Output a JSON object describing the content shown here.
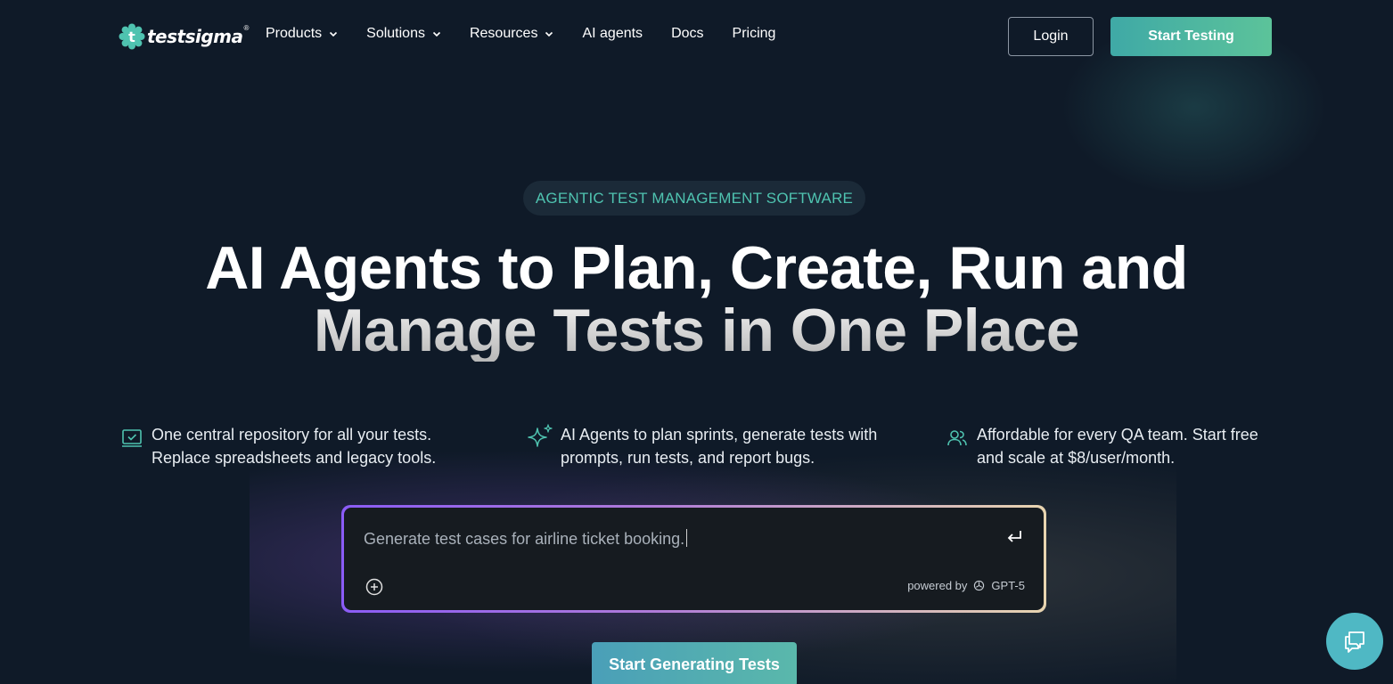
{
  "brand": {
    "name": "testsigma",
    "registered": "®",
    "accent": "#4fc3b0"
  },
  "nav": {
    "items": [
      {
        "label": "Products",
        "has_dropdown": true
      },
      {
        "label": "Solutions",
        "has_dropdown": true
      },
      {
        "label": "Resources",
        "has_dropdown": true
      },
      {
        "label": "AI agents",
        "has_dropdown": false
      },
      {
        "label": "Docs",
        "has_dropdown": false
      },
      {
        "label": "Pricing",
        "has_dropdown": false
      }
    ],
    "login_label": "Login",
    "start_label": "Start Testing"
  },
  "hero": {
    "badge": "AGENTIC TEST MANAGEMENT SOFTWARE",
    "headline_line1": "AI Agents to Plan, Create, Run and",
    "headline_line2": "Manage Tests in One Place",
    "features": [
      {
        "icon": "checked-monitor-icon",
        "line1": "One central repository for all your tests.",
        "line2": "Replace spreadsheets and legacy tools."
      },
      {
        "icon": "sparkle-icon",
        "line1": "AI Agents to plan sprints, generate tests with",
        "line2": "prompts, run tests, and report bugs."
      },
      {
        "icon": "users-icon",
        "line1": "Affordable for every QA team. Start free",
        "line2": "and scale at $8/user/month."
      }
    ]
  },
  "prompt": {
    "value": "Generate test cases for airline ticket booking.",
    "powered_by": "powered by",
    "model": "GPT-5"
  },
  "cta": {
    "label": "Start Generating Tests"
  },
  "chat": {
    "icon": "chat-icon"
  }
}
